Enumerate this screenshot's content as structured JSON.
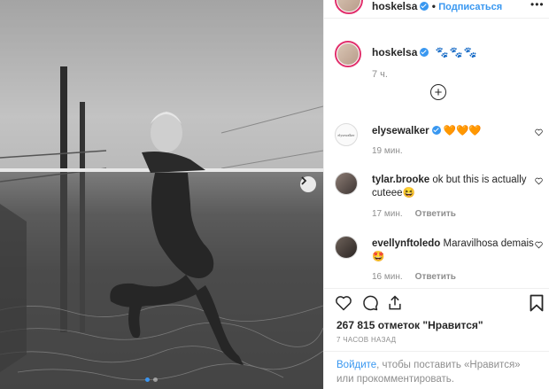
{
  "post": {
    "username": "hoskelsa",
    "separator": "•",
    "follow_label": "Подписаться",
    "more_label": "•••",
    "caption_emoji": "🐾🐾🐾",
    "caption_time": "7 ч.",
    "load_more_label": "+",
    "image_description_icon": "photo",
    "carousel_dots": 2,
    "carousel_active_index": 0
  },
  "comments": [
    {
      "username": "elysewalker",
      "text": "🧡🧡🧡",
      "time": "19 мин.",
      "reply_label": ""
    },
    {
      "username": "tylar.brooke",
      "text": "ok but this is actually cuteee😆",
      "time": "17 мин.",
      "reply_label": "Ответить"
    },
    {
      "username": "evellynftoledo",
      "text": "Maravilhosa demais 🤩",
      "time": "16 мин.",
      "reply_label": "Ответить"
    }
  ],
  "comment_avatars": {
    "elysewalker": "elysewalker"
  },
  "actions": {
    "like_icon": "heart-icon",
    "comment_icon": "comment-icon",
    "share_icon": "share-icon",
    "save_icon": "bookmark-icon"
  },
  "likes_text": "267 815 отметок \"Нравится\"",
  "time_ago": "7 ЧАСОВ НАЗАД",
  "login_prompt": {
    "link": "Войдите",
    "text": ", чтобы поставить «Нравится» или прокомментировать."
  },
  "colors": {
    "accent": "#3897f0",
    "text": "#262626",
    "muted": "#8e8e8e",
    "story_ring": "#e1306c"
  }
}
